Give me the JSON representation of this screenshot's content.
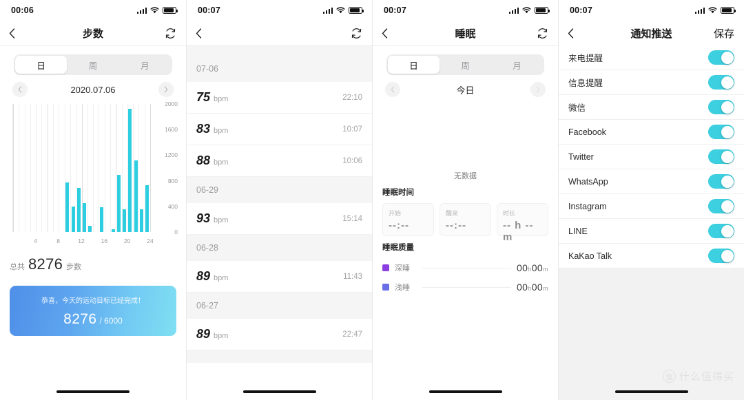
{
  "panels": {
    "steps": {
      "status": {
        "time": "00:06"
      },
      "nav": {
        "title": "步数",
        "back_icon": "chevron-left-icon",
        "refresh_icon": "refresh-icon"
      },
      "segments": [
        {
          "label": "日",
          "active": true
        },
        {
          "label": "周",
          "active": false
        },
        {
          "label": "月",
          "active": false
        }
      ],
      "date": {
        "prev_icon": "chevron-left-icon",
        "label": "2020.07.06",
        "next_icon": "chevron-right-icon"
      },
      "total": {
        "prefix": "总共",
        "value": "8276",
        "suffix": "步数"
      },
      "banner": {
        "message": "恭喜，今天的运动目标已经完成！",
        "current": "8276",
        "goal": "/ 6000",
        "gradient_from": "#4f8fe8",
        "gradient_to": "#7fdff2"
      }
    },
    "heart_rate": {
      "status": {
        "time": "00:07"
      },
      "nav": {
        "title": "",
        "back_icon": "chevron-left-icon",
        "refresh_icon": "refresh-icon"
      },
      "groups": [
        {
          "date": "07-06",
          "entries": [
            {
              "value": "75",
              "unit": "bpm",
              "time": "22:10"
            },
            {
              "value": "83",
              "unit": "bpm",
              "time": "10:07"
            },
            {
              "value": "88",
              "unit": "bpm",
              "time": "10:06"
            }
          ]
        },
        {
          "date": "06-29",
          "entries": [
            {
              "value": "93",
              "unit": "bpm",
              "time": "15:14"
            }
          ]
        },
        {
          "date": "06-28",
          "entries": [
            {
              "value": "89",
              "unit": "bpm",
              "time": "11:43"
            }
          ]
        },
        {
          "date": "06-27",
          "entries": [
            {
              "value": "89",
              "unit": "bpm",
              "time": "22:47"
            }
          ]
        }
      ]
    },
    "sleep": {
      "status": {
        "time": "00:07"
      },
      "nav": {
        "title": "睡眠",
        "back_icon": "chevron-left-icon",
        "refresh_icon": "refresh-icon"
      },
      "segments": [
        {
          "label": "日",
          "active": true
        },
        {
          "label": "周",
          "active": false
        },
        {
          "label": "月",
          "active": false
        }
      ],
      "date": {
        "prev_icon": "chevron-left-icon",
        "label": "今日",
        "next_icon": "chevron-right-icon"
      },
      "empty_text": "无数据",
      "time_section": {
        "title": "睡眠时间",
        "cards": [
          {
            "label": "开始",
            "value": "--:--",
            "unit": ""
          },
          {
            "label": "醒来",
            "value": "--:--",
            "unit": ""
          },
          {
            "label": "时长",
            "value": "-- h -- m",
            "unit": ""
          }
        ]
      },
      "quality_section": {
        "title": "睡眠质量",
        "rows": [
          {
            "name": "深睡",
            "color": "#8b3fe0",
            "hours": "00",
            "h_unit": "h",
            "minutes": "00",
            "m_unit": "m"
          },
          {
            "name": "浅睡",
            "color": "#6a6ee8",
            "hours": "00",
            "h_unit": "h",
            "minutes": "00",
            "m_unit": "m"
          }
        ]
      }
    },
    "notifications": {
      "status": {
        "time": "00:07"
      },
      "nav": {
        "title": "通知推送",
        "back_icon": "chevron-left-icon",
        "save_label": "保存"
      },
      "toggle_color": "#3cd0e0",
      "items": [
        {
          "label": "来电提醒",
          "on": true
        },
        {
          "label": "信息提醒",
          "on": true
        },
        {
          "label": "微信",
          "on": true
        },
        {
          "label": "Facebook",
          "on": true
        },
        {
          "label": "Twitter",
          "on": true
        },
        {
          "label": "WhatsApp",
          "on": true
        },
        {
          "label": "Instagram",
          "on": true
        },
        {
          "label": "LINE",
          "on": true
        },
        {
          "label": "KaKao Talk",
          "on": true
        }
      ]
    }
  },
  "watermark": {
    "mark": "值",
    "text": "什么值得买"
  },
  "chart_data": {
    "type": "bar",
    "title": "步数",
    "xlabel": "",
    "ylabel": "",
    "ylim": [
      0,
      2000
    ],
    "yticks": [
      0,
      400,
      800,
      1200,
      1600,
      2000
    ],
    "xticks": [
      4,
      8,
      12,
      16,
      20,
      24
    ],
    "xlim": [
      0,
      24
    ],
    "grid": true,
    "bar_color": "#2ccee0",
    "categories": [
      0,
      1,
      2,
      3,
      4,
      5,
      6,
      7,
      8,
      9,
      10,
      11,
      12,
      13,
      14,
      15,
      16,
      17,
      18,
      19,
      20,
      21,
      22,
      23
    ],
    "values": [
      0,
      0,
      0,
      0,
      0,
      0,
      0,
      0,
      0,
      770,
      400,
      690,
      450,
      100,
      0,
      390,
      0,
      25,
      890,
      355,
      1930,
      1120,
      350,
      735
    ],
    "total": 8276,
    "goal": 6000
  }
}
